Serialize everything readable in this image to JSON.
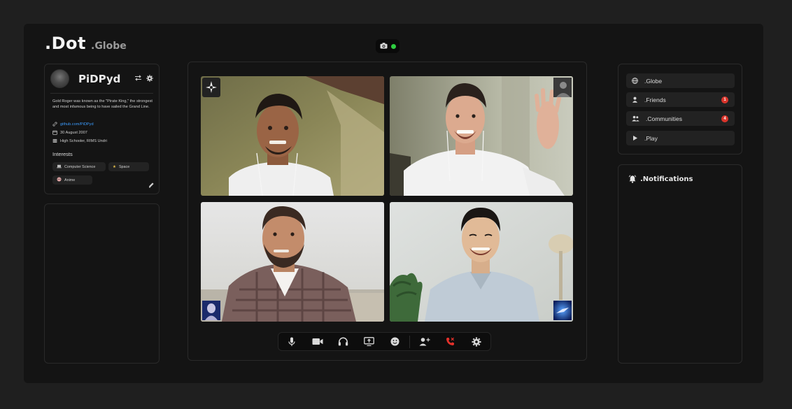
{
  "app": {
    "logo_main": ".Dot",
    "logo_sub": ".Globe"
  },
  "camera_status": {
    "icon": "camera-icon",
    "status_color": "#2ecc40"
  },
  "profile": {
    "username": "PiDPyd",
    "bio": "Gold Roger was known as the \"Pirate King,\" the strongest and most infamous being to have sailed the Grand Line.",
    "github": "github.com/PiDPyd",
    "birthday": "30 August 2007",
    "education": "High Schooler, RIMS Undri",
    "interests_title": "Interests",
    "interests": [
      {
        "label": "Computer Science",
        "icon": "laptop-icon"
      },
      {
        "label": "Space",
        "icon": "star-icon"
      },
      {
        "label": "Anime",
        "icon": "anime-icon"
      }
    ]
  },
  "call": {
    "tiles": [
      {
        "name": "participant-1",
        "badge": "compass-icon"
      },
      {
        "name": "participant-2",
        "badge": "avatar-thumb"
      },
      {
        "name": "participant-3",
        "badge": "statue-avatar"
      },
      {
        "name": "participant-4",
        "badge": "space-avatar"
      }
    ],
    "controls": [
      "microphone-icon",
      "video-camera-icon",
      "headphones-icon",
      "screen-share-icon",
      "emoji-icon",
      "add-user-icon",
      "end-call-icon",
      "settings-icon"
    ],
    "end_call_color": "#e5312b"
  },
  "nav": {
    "items": [
      {
        "label": ".Globe",
        "icon": "globe-icon",
        "badge": ""
      },
      {
        "label": ".Friends",
        "icon": "person-icon",
        "badge": "1"
      },
      {
        "label": ".Communities",
        "icon": "group-icon",
        "badge": "4"
      },
      {
        "label": ".Play",
        "icon": "play-icon",
        "badge": ""
      }
    ],
    "badge_color": "#d9342b"
  },
  "notifications": {
    "title": ".Notifications",
    "icon": "bell-icon"
  }
}
